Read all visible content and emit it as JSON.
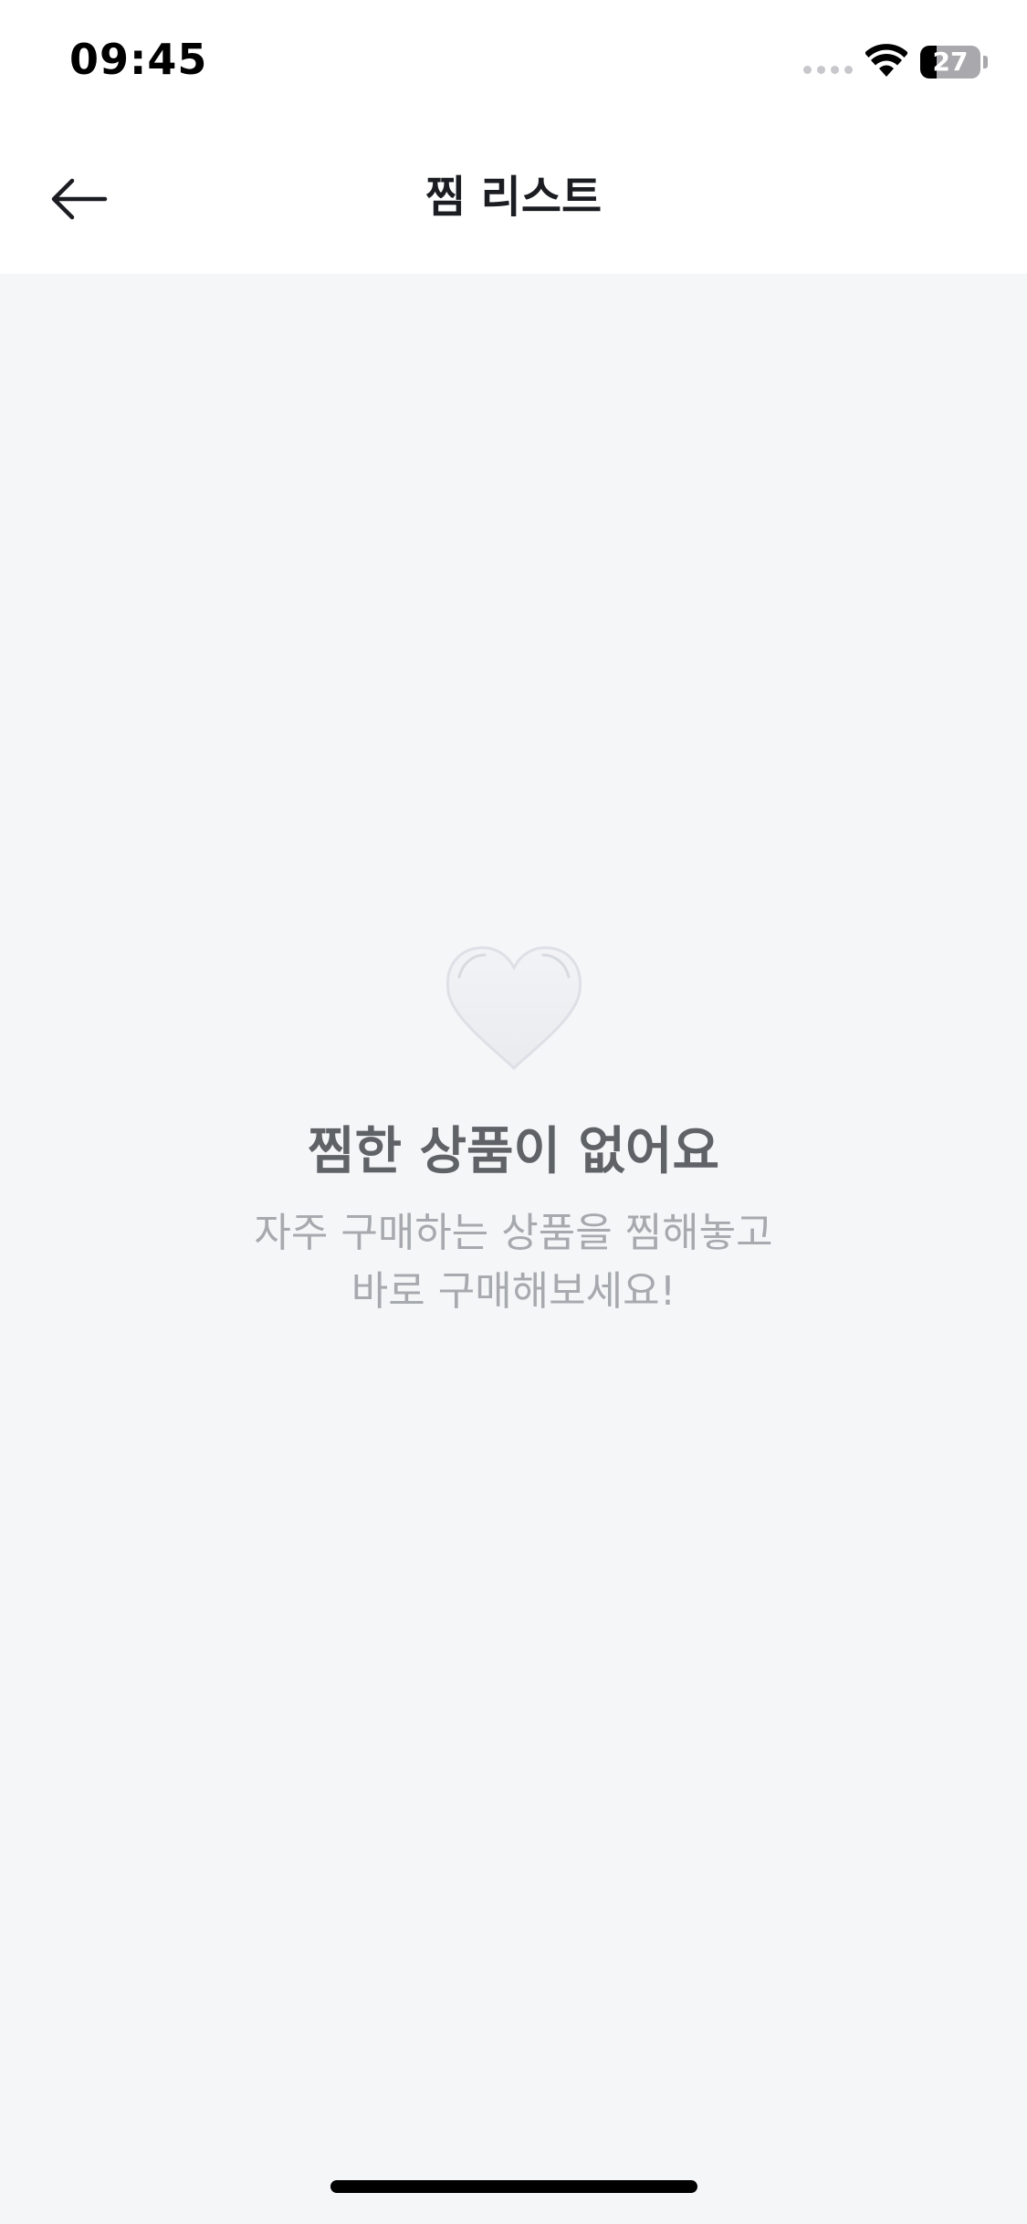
{
  "status_bar": {
    "time": "09:45",
    "battery_level": "27",
    "battery_percent": 27
  },
  "header": {
    "title": "찜 리스트",
    "back_icon": "arrow-left-icon"
  },
  "empty_state": {
    "icon": "heart-icon",
    "title": "찜한 상품이 없어요",
    "description_line1": "자주 구매하는 상품을 찜해놓고",
    "description_line2": "바로 구매해보세요!"
  },
  "colors": {
    "background": "#f5f6f8",
    "title": "#5f6368",
    "description": "#a6a9ae",
    "header_text": "#1b1d22"
  }
}
